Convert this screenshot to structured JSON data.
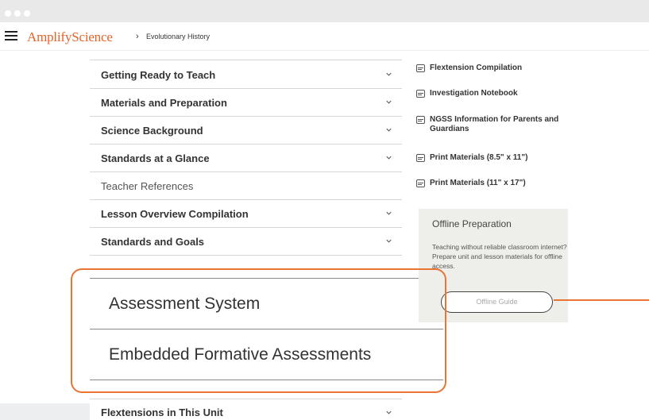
{
  "header": {
    "brand_amplify": "Amplify",
    "brand_science": "Science",
    "breadcrumb_separator": "›",
    "breadcrumb": "Evolutionary History"
  },
  "accordion": {
    "items": [
      {
        "label": "Getting Ready to Teach"
      },
      {
        "label": "Materials and Preparation"
      },
      {
        "label": "Science Background"
      },
      {
        "label": "Standards at a Glance"
      }
    ],
    "section_label": "Teacher References",
    "items2": [
      {
        "label": "Lesson Overview Compilation"
      },
      {
        "label": "Standards and Goals"
      }
    ],
    "zoomed": [
      {
        "label": "Assessment System"
      },
      {
        "label": "Embedded Formative Assessments"
      }
    ],
    "bottom": {
      "label": "Flextensions in This Unit"
    }
  },
  "resources": [
    {
      "label": "Flextension Compilation"
    },
    {
      "label": "Investigation Notebook"
    },
    {
      "label": "NGSS Information for Parents and Guardians"
    },
    {
      "label": "Print Materials (8.5\" x 11\")"
    },
    {
      "label": "Print Materials (11\" x 17\")"
    }
  ],
  "offline": {
    "title": "Offline Preparation",
    "description": "Teaching without reliable classroom internet? Prepare unit and lesson materials for offline access.",
    "button": "Offline Guide"
  },
  "colors": {
    "accent": "#e5632a",
    "highlight": "#e87534"
  }
}
